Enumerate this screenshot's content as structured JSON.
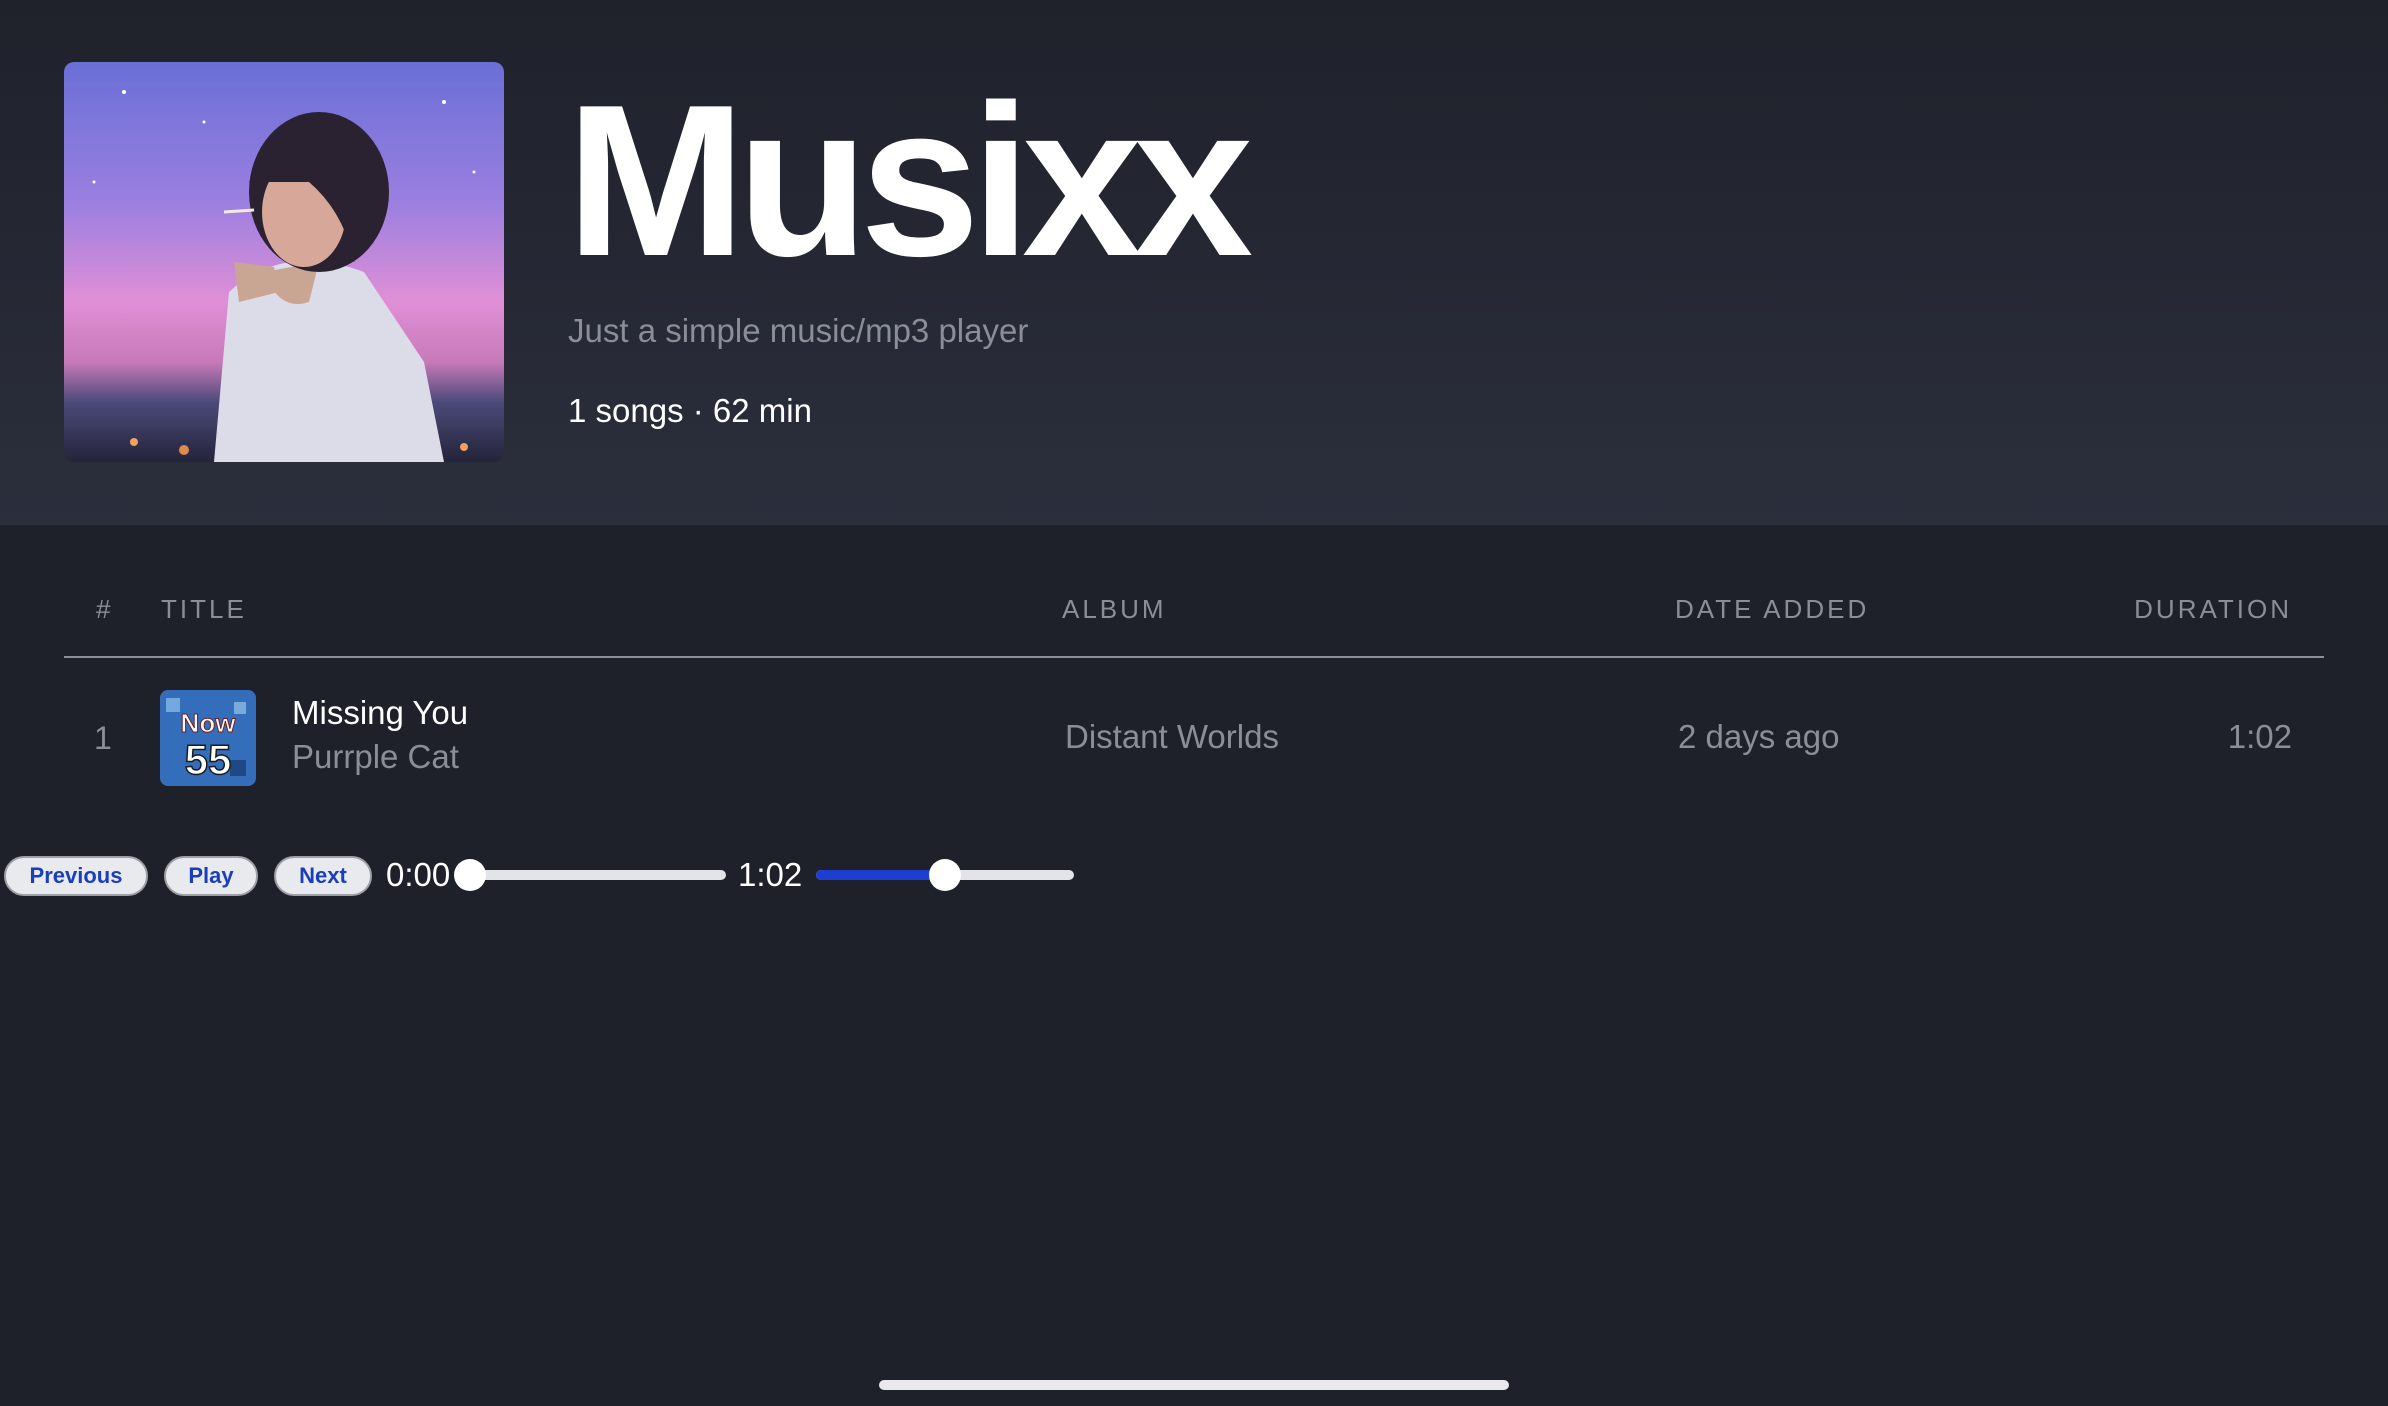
{
  "header": {
    "app_title": "Musixx",
    "subtitle": "Just a simple music/mp3 player",
    "meta": "1 songs · 62 min",
    "cover_image": "anime-girl-smoking-at-dusk"
  },
  "table": {
    "columns": [
      "#",
      "TITLE",
      "ALBUM",
      "DATE ADDED",
      "DURATION"
    ],
    "rows": [
      {
        "number": "1",
        "thumbnail": "now-55-album-art",
        "thumbnail_text": [
          "Now",
          "55"
        ],
        "title": "Missing You",
        "artist": "Purrple Cat",
        "album": "Distant Worlds",
        "date_added": "2 days ago",
        "duration": "1:02"
      }
    ]
  },
  "player": {
    "previous_label": "Previous",
    "play_label": "Play",
    "next_label": "Next",
    "current_time": "0:00",
    "total_time": "1:02",
    "progress_fraction": 0.0,
    "volume_fraction": 0.5,
    "accent_color": "#1d3fd1"
  },
  "theme": {
    "background": "#1f212a",
    "header_gradient_end": "#2b2f3c",
    "muted_text": "#8b8e97"
  }
}
